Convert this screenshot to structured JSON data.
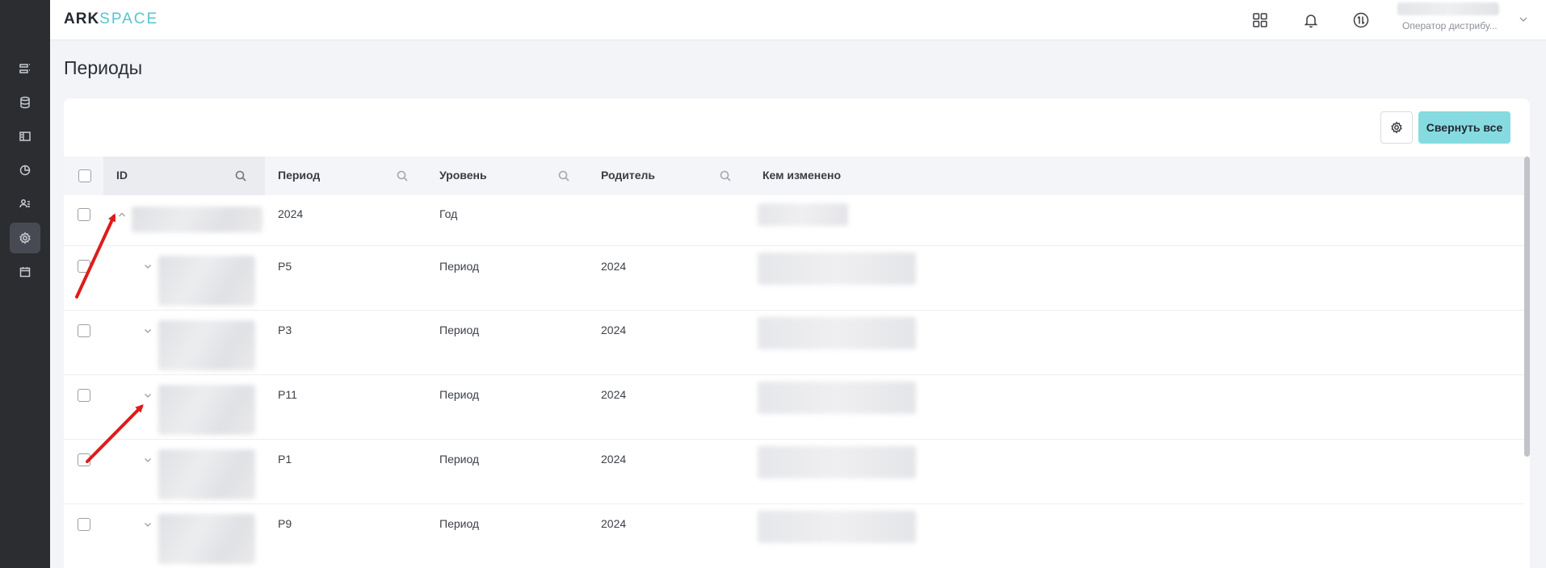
{
  "app": {
    "logo_part1": "ARK",
    "logo_part2": "SPACE"
  },
  "header": {
    "user_role": "Оператор дистрибу..."
  },
  "page": {
    "title": "Периоды"
  },
  "toolbar": {
    "collapse_all_label": "Свернуть все"
  },
  "table": {
    "columns": [
      "ID",
      "Период",
      "Уровень",
      "Родитель",
      "Кем изменено"
    ],
    "rows": [
      {
        "period": "2024",
        "level": "Год",
        "parent": "",
        "expanded": true
      },
      {
        "period": "P5",
        "level": "Период",
        "parent": "2024",
        "expanded": false
      },
      {
        "period": "P3",
        "level": "Период",
        "parent": "2024",
        "expanded": false
      },
      {
        "period": "P11",
        "level": "Период",
        "parent": "2024",
        "expanded": false
      },
      {
        "period": "P1",
        "level": "Период",
        "parent": "2024",
        "expanded": false
      },
      {
        "period": "P9",
        "level": "Период",
        "parent": "2024",
        "expanded": false
      }
    ]
  },
  "colors": {
    "accent": "#86dbe0",
    "logo_accent": "#53c6cf",
    "sidebar_bg": "#2b2d31",
    "annotation_arrow": "#e01b1b"
  }
}
